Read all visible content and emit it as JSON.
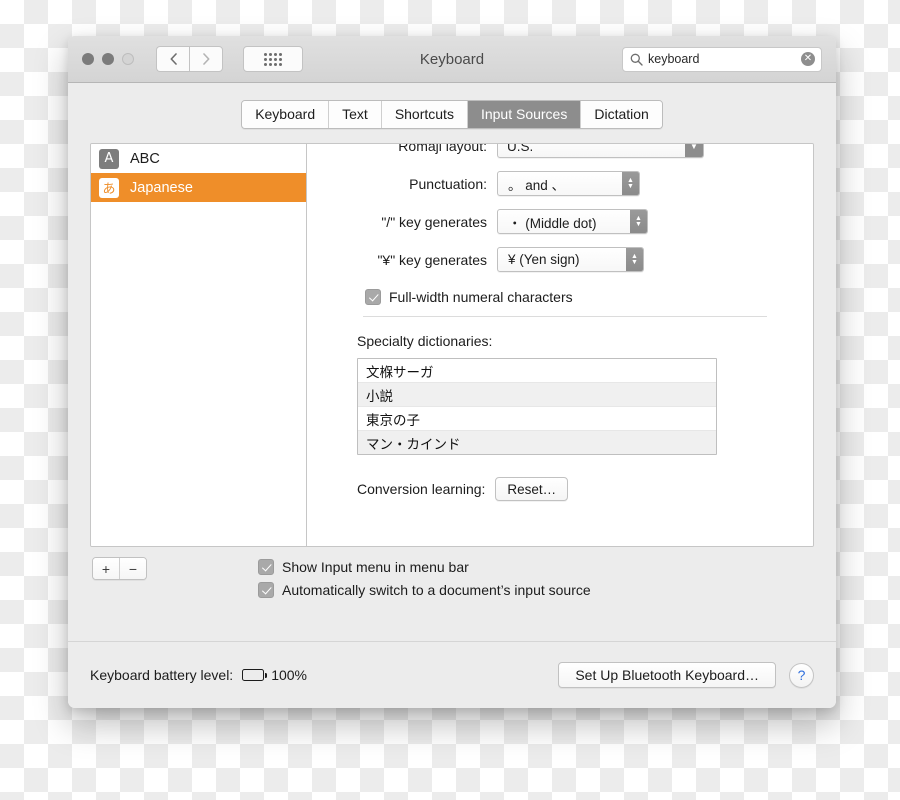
{
  "window": {
    "title": "Keyboard",
    "traffic_lights": [
      "close-button",
      "minimize-button",
      "zoom-button"
    ],
    "nav": {
      "back": "‹",
      "forward": "›"
    },
    "grid_button": "show-all-button",
    "search": {
      "value": "keyboard",
      "placeholder": "Search",
      "clear": "✕"
    }
  },
  "tabs": [
    {
      "label": "Keyboard",
      "selected": false
    },
    {
      "label": "Text",
      "selected": false
    },
    {
      "label": "Shortcuts",
      "selected": false
    },
    {
      "label": "Input Sources",
      "selected": true
    },
    {
      "label": "Dictation",
      "selected": false
    }
  ],
  "input_sources": [
    {
      "icon": "A",
      "label": "ABC",
      "selected": false
    },
    {
      "icon": "あ",
      "label": "Japanese",
      "selected": true
    }
  ],
  "settings": {
    "romaji_layout": {
      "label": "Romaji layout:",
      "value": "U.S."
    },
    "punctuation": {
      "label": "Punctuation:",
      "value": "。 and 、"
    },
    "slash_key": {
      "label": "\"/\" key generates",
      "value": "・ (Middle dot)"
    },
    "yen_key": {
      "label": "\"¥\" key generates",
      "value": "¥ (Yen sign)"
    },
    "full_width": {
      "label": "Full-width numeral characters",
      "checked": true
    }
  },
  "dictionaries": {
    "label": "Specialty dictionaries:",
    "items": [
      "文椺サーガ",
      "小説",
      "東京の子",
      "マン・カインド"
    ]
  },
  "conversion_learning": {
    "label": "Conversion learning:",
    "button": "Reset…"
  },
  "list_controls": {
    "add": "+",
    "remove": "−"
  },
  "bottom_options": [
    {
      "label": "Show Input menu in menu bar",
      "checked": true
    },
    {
      "label": "Automatically switch to a document’s input source",
      "checked": true
    }
  ],
  "footer": {
    "battery_label": "Keyboard battery level:",
    "battery_value": "100%",
    "setup_button": "Set Up Bluetooth Keyboard…",
    "help_button": "?"
  },
  "colors": {
    "accent_selection": "#ef8e29",
    "tab_selected": "#8d8d8d",
    "help_blue": "#2f6fdd"
  }
}
